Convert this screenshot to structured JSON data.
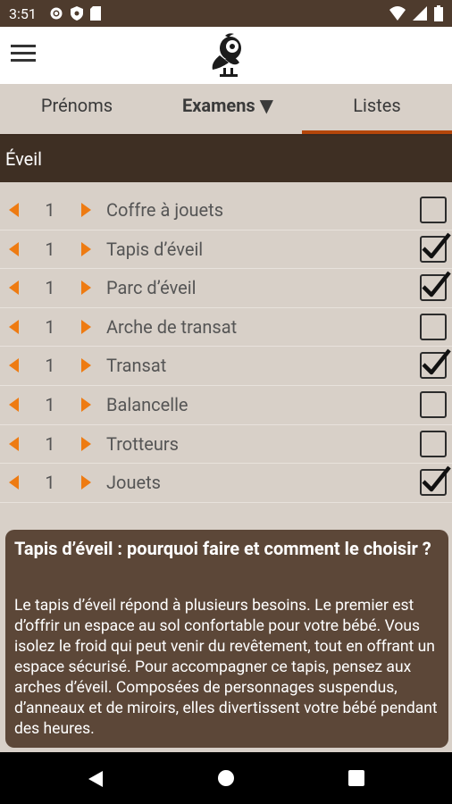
{
  "status": {
    "time": "3:51",
    "icons": [
      "gear-icon",
      "shield-icon",
      "sd-card-icon",
      "wifi-icon",
      "signal-icon",
      "battery-icon"
    ]
  },
  "appbar": {
    "menu_icon": "hamburger-menu-icon",
    "logo": "bird-logo"
  },
  "tabs": [
    {
      "label": "Prénoms",
      "active": false
    },
    {
      "label": "Examens ▼",
      "active": false
    },
    {
      "label": "Listes",
      "active": true
    }
  ],
  "section": {
    "title": "Éveil"
  },
  "items": [
    {
      "qty": "1",
      "label": "Coffre à jouets",
      "checked": false
    },
    {
      "qty": "1",
      "label": "Tapis d’éveil",
      "checked": true
    },
    {
      "qty": "1",
      "label": "Parc d’éveil",
      "checked": true
    },
    {
      "qty": "1",
      "label": "Arche de transat",
      "checked": false
    },
    {
      "qty": "1",
      "label": "Transat",
      "checked": true
    },
    {
      "qty": "1",
      "label": "Balancelle",
      "checked": false
    },
    {
      "qty": "1",
      "label": "Trotteurs",
      "checked": false
    },
    {
      "qty": "1",
      "label": "Jouets",
      "checked": true
    }
  ],
  "info": {
    "title": "Tapis d’éveil : pourquoi faire et comment le choisir ?",
    "body": "Le tapis d’éveil répond à plusieurs besoins. Le premier est d’offrir un espace au sol confortable pour votre bébé. Vous isolez le froid qui peut venir du revêtement, tout en offrant un espace sécurisé. Pour accompagner ce tapis, pensez aux arches d’éveil. Composées de personnages suspendus, d’anneaux et de miroirs, elles divertissent votre bébé pendant des heures."
  },
  "colors": {
    "accent": "#ee7b12",
    "brown_dark": "#3e2f23",
    "card": "#5c4738",
    "background": "#d8d0c8"
  }
}
